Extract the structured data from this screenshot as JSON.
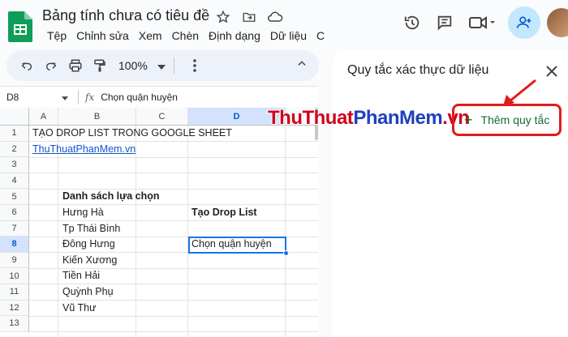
{
  "doc": {
    "title": "Bảng tính chưa có tiêu đề",
    "menu": [
      "Tệp",
      "Chỉnh sửa",
      "Xem",
      "Chèn",
      "Định dạng",
      "Dữ liệu",
      "C"
    ]
  },
  "toolbar": {
    "zoom": "100%"
  },
  "formula_bar": {
    "cell_ref": "D8",
    "content": "Chọn quận huyện"
  },
  "sheet": {
    "columns": [
      "A",
      "B",
      "C",
      "D"
    ],
    "selected_column": "D",
    "rows": [
      "1",
      "2",
      "3",
      "4",
      "5",
      "6",
      "7",
      "8",
      "9",
      "10",
      "11",
      "12",
      "13"
    ],
    "selected_row": "8",
    "cells": {
      "a1": "TẠO DROP LIST TRONG GOOGLE SHEET",
      "a2": "ThuThuatPhanMem.vn",
      "b5": "Danh sách lựa chọn",
      "b6": "Hưng Hà",
      "d6": "Tạo Drop List",
      "b7": "Tp Thái Bình",
      "b8": "Đông Hưng",
      "d8": "Chọn quận huyện",
      "b9": "Kiến Xương",
      "b10": "Tiền Hải",
      "b11": "Quỳnh Phụ",
      "b12": "Vũ Thư"
    }
  },
  "panel": {
    "title": "Quy tắc xác thực dữ liệu",
    "add_rule": "Thêm quy tắc"
  },
  "watermark": {
    "part1": "ThuThuat",
    "part2": "PhanMem",
    "part3": ".vn"
  },
  "colors": {
    "accent": "#1a73e8",
    "highlight_border": "#e21b1b",
    "add_rule_text": "#146c2e",
    "link": "#1155cc"
  }
}
